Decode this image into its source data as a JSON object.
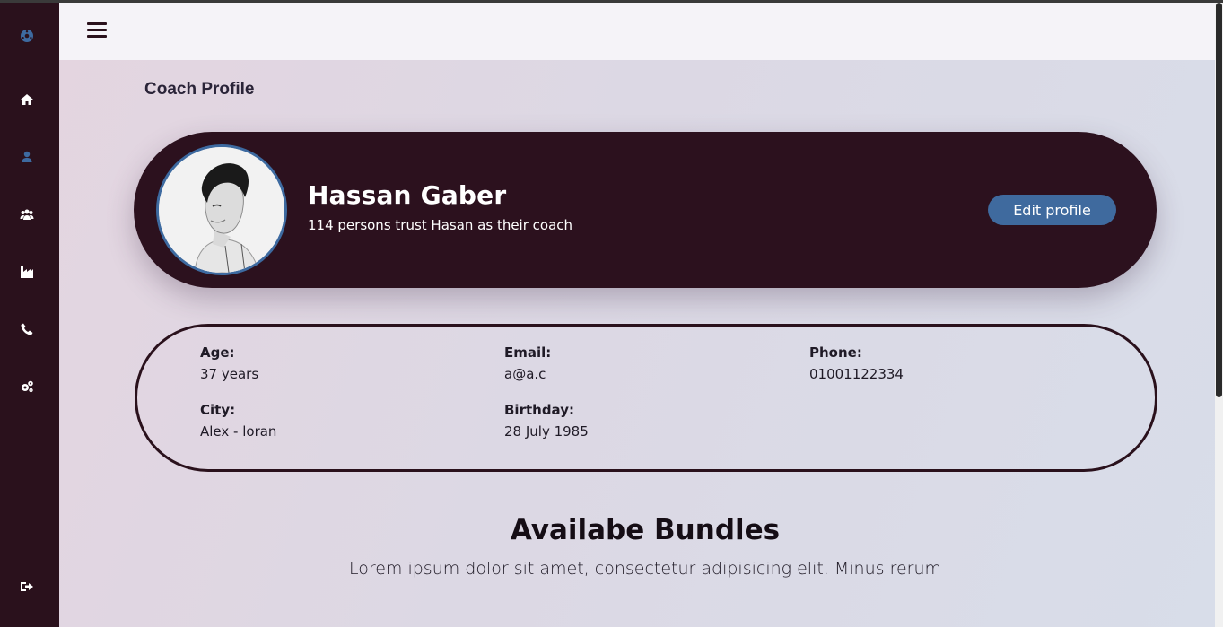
{
  "sidebar": {
    "icons": [
      {
        "name": "logo-ball-icon"
      },
      {
        "name": "home-icon"
      },
      {
        "name": "user-icon"
      },
      {
        "name": "users-icon"
      },
      {
        "name": "industry-icon"
      },
      {
        "name": "phone-icon"
      },
      {
        "name": "settings-icon"
      },
      {
        "name": "logout-icon"
      }
    ],
    "active_color": "#3d6aa0"
  },
  "header": {
    "menu_icon": "hamburger-icon"
  },
  "page": {
    "title": "Coach Profile"
  },
  "profile": {
    "name": "Hassan Gaber",
    "trust_text": "114 persons trust Hasan as their coach",
    "edit_button": "Edit profile"
  },
  "info": {
    "age_label": "Age:",
    "age_value": "37 years",
    "email_label": "Email:",
    "email_value": "a@a.c",
    "phone_label": "Phone:",
    "phone_value": "01001122334",
    "city_label": "City:",
    "city_value": "Alex - loran",
    "birthday_label": "Birthday:",
    "birthday_value": "28 July 1985"
  },
  "bundles": {
    "title": "Availabe Bundles",
    "description": "Lorem ipsum dolor sit amet, consectetur adipisicing elit. Minus rerum"
  },
  "colors": {
    "sidebar_bg": "#2a111c",
    "card_bg": "#2c111e",
    "accent": "#3f6a9e"
  }
}
